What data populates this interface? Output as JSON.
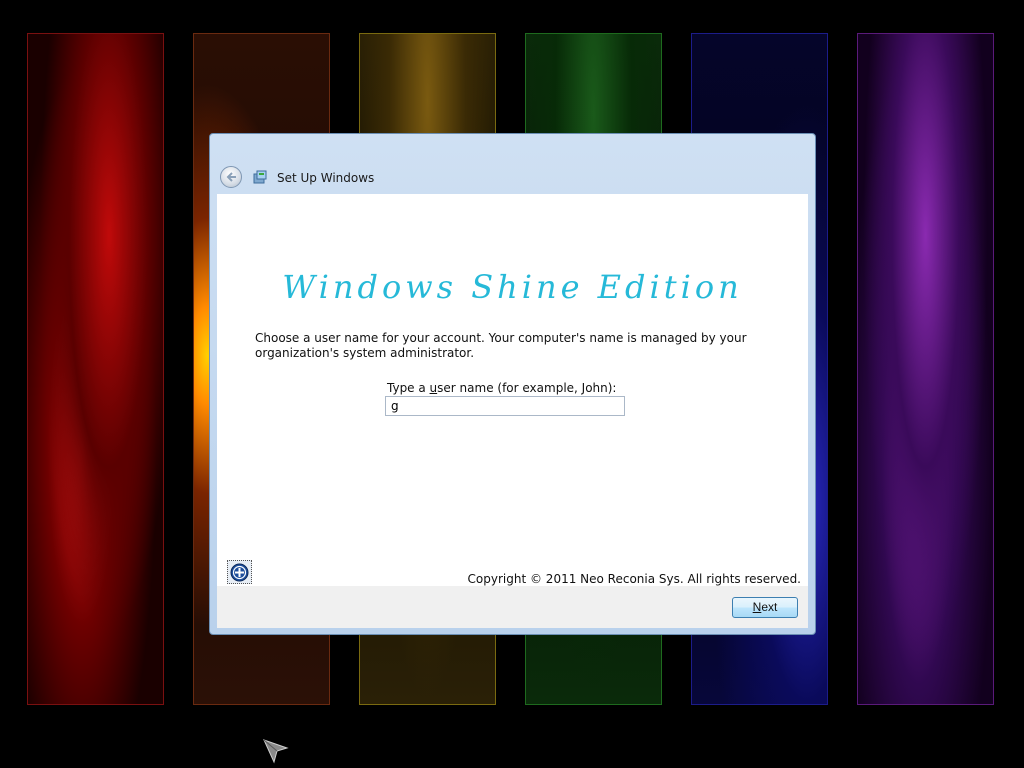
{
  "background": {
    "panels": [
      "red-fractal",
      "orange-fractal",
      "yellow-fractal",
      "green-fractal",
      "blue-fractal",
      "purple-fractal"
    ]
  },
  "dialog": {
    "title": "Set Up Windows",
    "brand": "Windows Shine Edition",
    "instructions": "Choose a user name for your account.  Your computer's name is managed by your organization's system administrator.",
    "username_label_pre": "Type a ",
    "username_label_access": "u",
    "username_label_post": "ser name (for example, John):",
    "username_value": "g",
    "copyright": "Copyright © 2011 Neo Reconia Sys.  All rights reserved.",
    "next_label_access": "N",
    "next_label_rest": "ext"
  },
  "colors": {
    "brand_text": "#26b9d8",
    "titlebar": "#c4d9f0",
    "button_border": "#3c7fb1"
  },
  "icons": [
    "back-arrow-icon",
    "setup-windows-icon",
    "accessibility-icon",
    "mouse-pointer-icon"
  ]
}
